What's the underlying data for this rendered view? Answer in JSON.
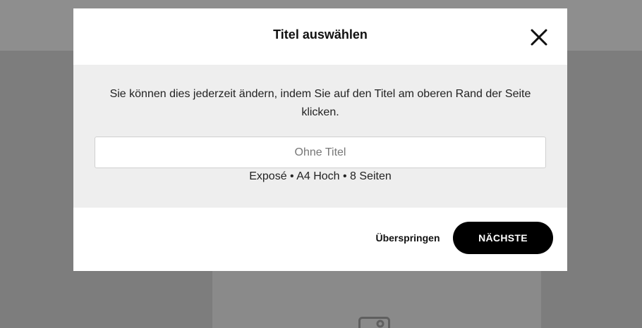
{
  "modal": {
    "title": "Titel auswählen",
    "close_icon": "close-icon",
    "description": "Sie können dies jederzeit ändern, indem Sie auf den Titel am oberen Rand der Seite klicken.",
    "title_input": {
      "value": "",
      "placeholder": "Ohne Titel"
    },
    "doc_meta": "Exposé • A4 Hoch • 8 Seiten",
    "skip_label": "Überspringen",
    "next_label": "NÄCHSTE"
  },
  "background": {
    "image_icon": "image-placeholder-icon"
  },
  "colors": {
    "overlay": "#7d7d7d",
    "modal_body": "#eeeeee",
    "primary_button": "#000000"
  }
}
